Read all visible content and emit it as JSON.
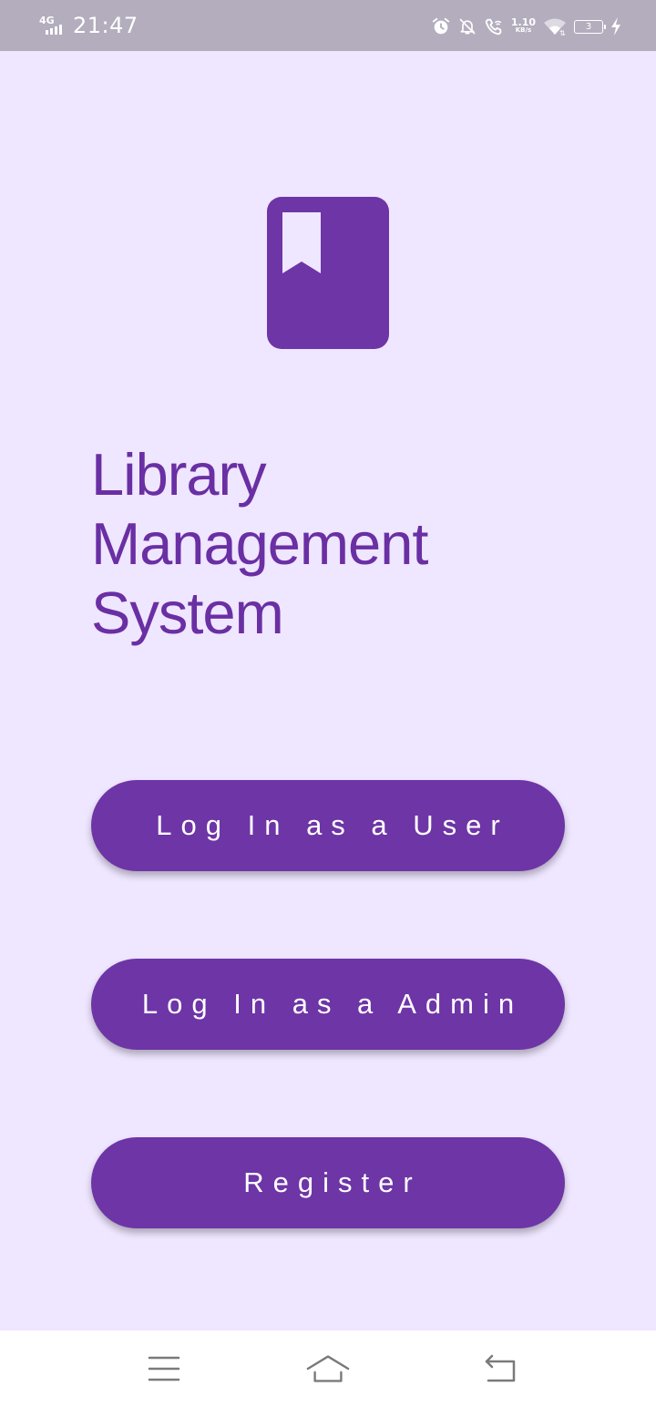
{
  "status_bar": {
    "network": "4G",
    "time": "21:47",
    "speed_value": "1.10",
    "speed_unit": "KB/s",
    "battery_level": "3",
    "icons": [
      "signal-icon",
      "alarm-icon",
      "notifications-off-icon",
      "wifi-calling-icon",
      "wifi-icon",
      "battery-icon",
      "charging-icon"
    ]
  },
  "app": {
    "logo_icon": "book-bookmark-icon",
    "title_lines": [
      "Library",
      "Management",
      "System"
    ],
    "accent_color": "#6e35a6",
    "background_color": "#efe6ff"
  },
  "buttons": {
    "login_user": "Log In as a User",
    "login_admin": "Log In as a Admin",
    "register": "Register"
  },
  "navigation_bar": {
    "icons": [
      "menu-icon",
      "home-icon",
      "back-icon"
    ]
  }
}
